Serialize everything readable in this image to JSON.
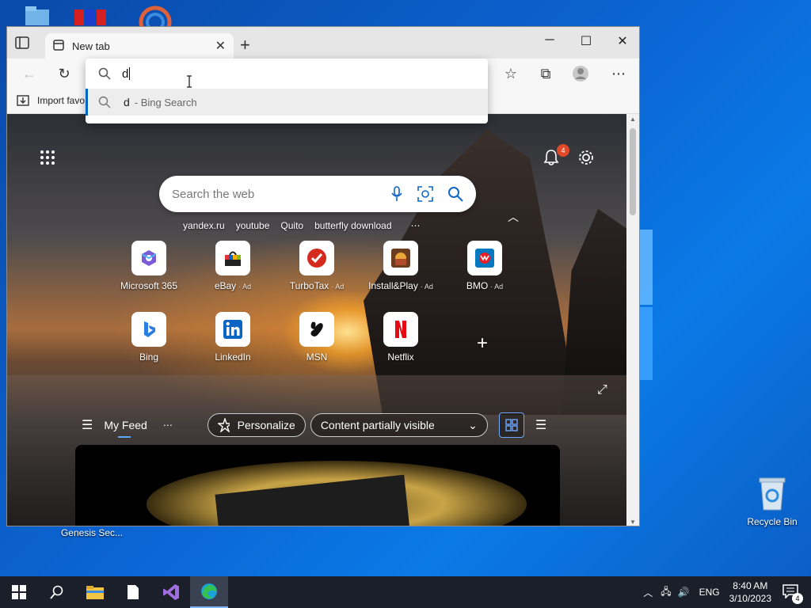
{
  "browser": {
    "tab": {
      "title": "New tab"
    },
    "favorites": {
      "import_label": "Import favo"
    },
    "address": {
      "typed": "d",
      "suggestion_query": "d",
      "suggestion_suffix": "- Bing Search"
    }
  },
  "newtab": {
    "notification_count": "4",
    "search": {
      "placeholder": "Search the web"
    },
    "suggested_searches": [
      "yandex.ru",
      "youtube",
      "Quito",
      "butterfly download"
    ],
    "tiles_row1": [
      {
        "label": "Microsoft 365",
        "ad": "",
        "icon": "microsoft-365-icon"
      },
      {
        "label": "eBay",
        "ad": "· Ad",
        "icon": "ebay-icon"
      },
      {
        "label": "TurboTax",
        "ad": "· Ad",
        "icon": "turbotax-icon"
      },
      {
        "label": "Install&Play",
        "ad": "· Ad",
        "icon": "install-play-icon"
      },
      {
        "label": "BMO",
        "ad": "· Ad",
        "icon": "bmo-icon"
      }
    ],
    "tiles_row2": [
      {
        "label": "Bing",
        "icon": "bing-icon"
      },
      {
        "label": "LinkedIn",
        "icon": "linkedin-icon"
      },
      {
        "label": "MSN",
        "icon": "msn-icon"
      },
      {
        "label": "Netflix",
        "icon": "netflix-icon"
      }
    ],
    "feed": {
      "my_feed": "My Feed",
      "personalize": "Personalize",
      "visibility": "Content partially visible"
    }
  },
  "desktop": {
    "recycle_bin": "Recycle Bin",
    "genesis": "Genesis Sec..."
  },
  "taskbar": {
    "language": "ENG",
    "time": "8:40 AM",
    "date": "3/10/2023",
    "notification_count": "4"
  }
}
